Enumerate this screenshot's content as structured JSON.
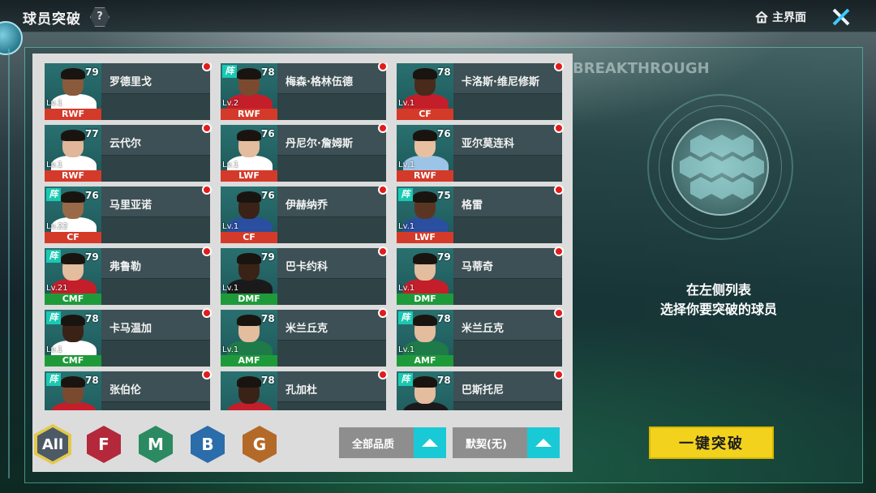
{
  "header": {
    "title": "球员突破",
    "help_glyph": "?",
    "home_label": "主界面"
  },
  "players": [
    {
      "name": "罗德里戈",
      "rating": "79",
      "level": "Lv.1",
      "position": "RWF",
      "pos_color": "red",
      "zhen": false,
      "skin": "#8a5a3c",
      "shirt": "#ffffff"
    },
    {
      "name": "梅森·格林伍德",
      "rating": "78",
      "level": "Lv.2",
      "position": "RWF",
      "pos_color": "red",
      "zhen": true,
      "skin": "#7a4a30",
      "shirt": "#c41e2a"
    },
    {
      "name": "卡洛斯·维尼修斯",
      "rating": "78",
      "level": "Lv.1",
      "position": "CF",
      "pos_color": "red",
      "zhen": false,
      "skin": "#4a2a1a",
      "shirt": "#c41e2a"
    },
    {
      "name": "云代尔",
      "rating": "77",
      "level": "Lv.1",
      "position": "RWF",
      "pos_color": "red",
      "zhen": false,
      "skin": "#e0b79a",
      "shirt": "#ffffff"
    },
    {
      "name": "丹尼尔·詹姆斯",
      "rating": "76",
      "level": "Lv.1",
      "position": "LWF",
      "pos_color": "red",
      "zhen": false,
      "skin": "#e4bc9e",
      "shirt": "#ffffff"
    },
    {
      "name": "亚尔莫连科",
      "rating": "76",
      "level": "Lv.1",
      "position": "RWF",
      "pos_color": "red",
      "zhen": false,
      "skin": "#e8c0a0",
      "shirt": "#9cc4e6"
    },
    {
      "name": "马里亚诺",
      "rating": "76",
      "level": "Lv.22",
      "position": "CF",
      "pos_color": "red",
      "zhen": true,
      "skin": "#9a6a48",
      "shirt": "#ffffff"
    },
    {
      "name": "伊赫纳乔",
      "rating": "76",
      "level": "Lv.1",
      "position": "CF",
      "pos_color": "red",
      "zhen": false,
      "skin": "#3a2216",
      "shirt": "#2a4ea0"
    },
    {
      "name": "格雷",
      "rating": "75",
      "level": "Lv.1",
      "position": "LWF",
      "pos_color": "red",
      "zhen": true,
      "skin": "#5a3622",
      "shirt": "#2a4ea0"
    },
    {
      "name": "弗鲁勒",
      "rating": "79",
      "level": "Lv.21",
      "position": "CMF",
      "pos_color": "green",
      "zhen": true,
      "skin": "#e4bc9e",
      "shirt": "#c41e2a"
    },
    {
      "name": "巴卡约科",
      "rating": "79",
      "level": "Lv.1",
      "position": "DMF",
      "pos_color": "green",
      "zhen": false,
      "skin": "#3a2216",
      "shirt": "#1a1a1a"
    },
    {
      "name": "马蒂奇",
      "rating": "79",
      "level": "Lv.1",
      "position": "DMF",
      "pos_color": "green",
      "zhen": false,
      "skin": "#e4bc9e",
      "shirt": "#c41e2a"
    },
    {
      "name": "卡马温加",
      "rating": "78",
      "level": "Lv.1",
      "position": "CMF",
      "pos_color": "green",
      "zhen": true,
      "skin": "#3a2216",
      "shirt": "#ffffff"
    },
    {
      "name": "米兰丘克",
      "rating": "78",
      "level": "Lv.1",
      "position": "AMF",
      "pos_color": "green",
      "zhen": false,
      "skin": "#e4bc9e",
      "shirt": "#1f7a4a"
    },
    {
      "name": "米兰丘克",
      "rating": "78",
      "level": "Lv.1",
      "position": "AMF",
      "pos_color": "green",
      "zhen": true,
      "skin": "#e4bc9e",
      "shirt": "#1f7a4a"
    },
    {
      "name": "张伯伦",
      "rating": "78",
      "level": "",
      "position": "",
      "pos_color": "green",
      "zhen": true,
      "skin": "#7a4a30",
      "shirt": "#c41e2a"
    },
    {
      "name": "孔加杜",
      "rating": "78",
      "level": "",
      "position": "",
      "pos_color": "green",
      "zhen": false,
      "skin": "#3a2216",
      "shirt": "#c41e2a"
    },
    {
      "name": "巴斯托尼",
      "rating": "78",
      "level": "",
      "position": "",
      "pos_color": "green",
      "zhen": true,
      "skin": "#e4bc9e",
      "shirt": "#1a1a1a"
    }
  ],
  "zhen_label": "阵",
  "filters": {
    "grades": [
      "All",
      "F",
      "M",
      "B",
      "G"
    ],
    "quality_label": "全部品质",
    "contract_label": "默契(无)"
  },
  "right": {
    "deco_text": "BREAKTHROUGH",
    "hint_line1": "在左侧列表",
    "hint_line2": "选择你要突破的球员",
    "oneclick_label": "一键突破"
  },
  "colors": {
    "accent_cyan": "#19c9d6",
    "button_yellow": "#f2d21c",
    "position_red": "#d43a2a",
    "position_green": "#1f9a3a",
    "notify_red": "#e21b1b"
  }
}
